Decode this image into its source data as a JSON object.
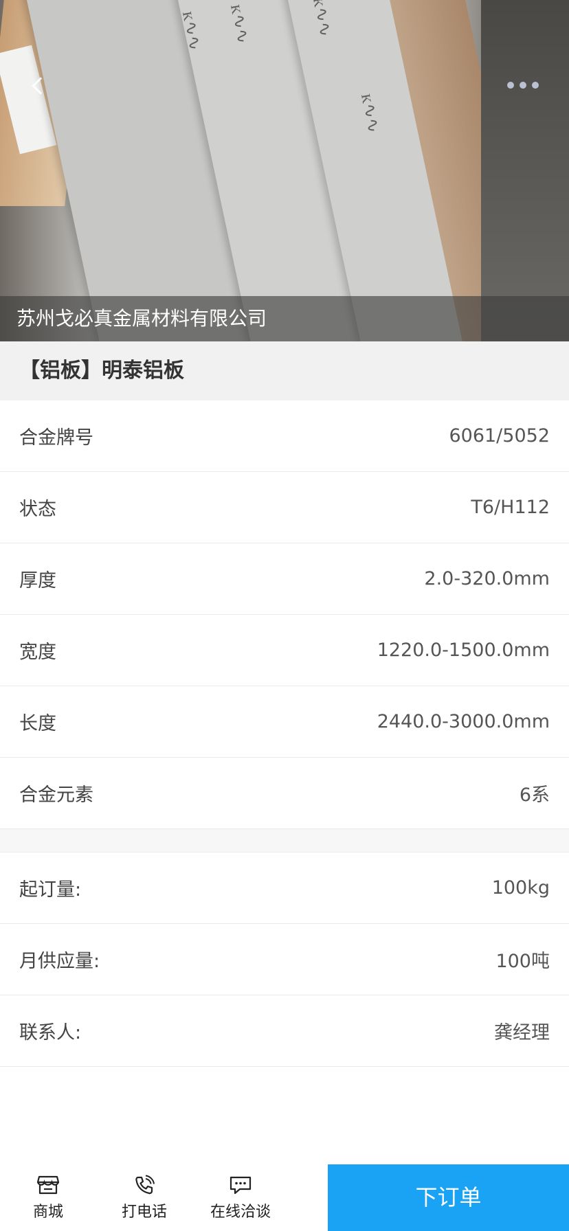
{
  "hero": {
    "company_name": "苏州戈必真金属材料有限公司"
  },
  "product": {
    "title": "【铝板】明泰铝板"
  },
  "specs": [
    {
      "label": "合金牌号",
      "value": "6061/5052"
    },
    {
      "label": "状态",
      "value": "T6/H112"
    },
    {
      "label": "厚度",
      "value": "2.0-320.0mm"
    },
    {
      "label": "宽度",
      "value": "1220.0-1500.0mm"
    },
    {
      "label": "长度",
      "value": "2440.0-3000.0mm"
    },
    {
      "label": "合金元素",
      "value": "6系"
    }
  ],
  "supply": [
    {
      "label": "起订量:",
      "value": "100kg"
    },
    {
      "label": "月供应量:",
      "value": "100吨"
    },
    {
      "label": "联系人:",
      "value": "龚经理"
    }
  ],
  "bottom_bar": {
    "tabs": [
      {
        "label": "商城",
        "icon": "store-icon"
      },
      {
        "label": "打电话",
        "icon": "phone-icon"
      },
      {
        "label": "在线洽谈",
        "icon": "chat-icon"
      }
    ],
    "order_label": "下订单",
    "order_color": "#1aa3f5"
  }
}
